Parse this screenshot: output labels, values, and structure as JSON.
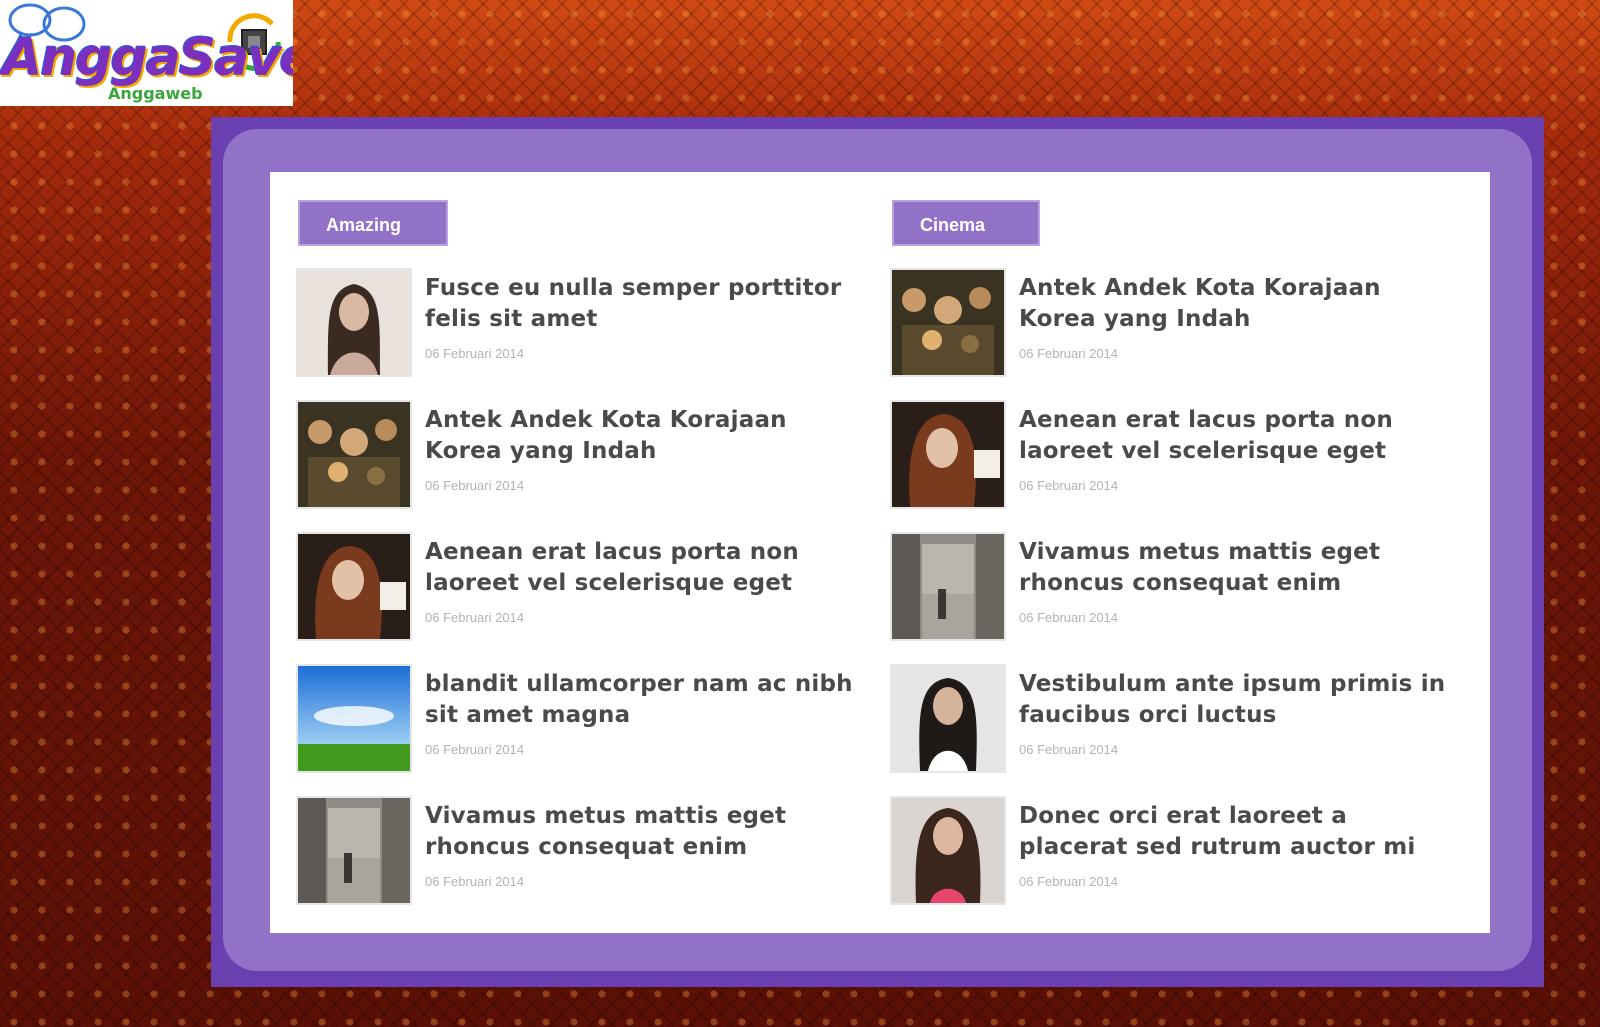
{
  "logo": {
    "brand": "AnggaSave",
    "sub": "Anggaweb"
  },
  "columns": [
    {
      "category": "Amazing",
      "items": [
        {
          "title": "Fusce eu nulla semper porttitor felis sit amet",
          "date": "06 Februari 2014",
          "thumb": "woman-portrait-icon"
        },
        {
          "title": "Antek Andek Kota Korajaan Korea yang Indah",
          "date": "06 Februari 2014",
          "thumb": "crowd-scene-icon"
        },
        {
          "title": "Aenean erat lacus porta non laoreet vel scelerisque eget",
          "date": "06 Februari 2014",
          "thumb": "redhead-portrait-icon"
        },
        {
          "title": "blandit ullamcorper nam ac nibh sit amet magna",
          "date": "06 Februari 2014",
          "thumb": "sky-field-icon"
        },
        {
          "title": "Vivamus metus mattis eget rhoncus consequat enim",
          "date": "06 Februari 2014",
          "thumb": "street-scene-icon"
        }
      ]
    },
    {
      "category": "Cinema",
      "items": [
        {
          "title": "Antek Andek Kota Korajaan Korea yang Indah",
          "date": "06 Februari 2014",
          "thumb": "crowd-scene-icon"
        },
        {
          "title": "Aenean erat lacus porta non laoreet vel scelerisque eget",
          "date": "06 Februari 2014",
          "thumb": "redhead-portrait-icon"
        },
        {
          "title": "Vivamus metus mattis eget rhoncus consequat enim",
          "date": "06 Februari 2014",
          "thumb": "street-scene-icon"
        },
        {
          "title": "Vestibulum ante ipsum primis in faucibus orci luctus",
          "date": "06 Februari 2014",
          "thumb": "woman-portrait-icon"
        },
        {
          "title": "Donec orci erat laoreet a placerat sed rutrum auctor mi",
          "date": "06 Februari 2014",
          "thumb": "woman-pink-portrait-icon"
        }
      ]
    }
  ],
  "colors": {
    "accent": "#9272c6",
    "frame": "#6a3fb0",
    "title": "#4a4a4a",
    "date": "#b3b3b3"
  }
}
